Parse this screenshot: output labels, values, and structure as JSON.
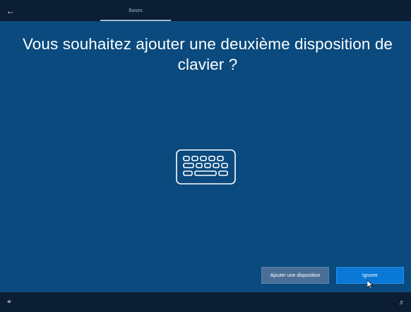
{
  "topbar": {
    "back_icon": "back-arrow-icon",
    "step_label": "Bases"
  },
  "main": {
    "title": "Vous souhaitez ajouter une deuxième disposition de clavier ?",
    "illustration_icon": "keyboard-icon"
  },
  "actions": {
    "add_layout_label": "Ajouter une disposition",
    "skip_label": "Ignorer"
  },
  "bottombar": {
    "left_icon": "ease-of-access-icon",
    "right_icon": "volume-icon"
  },
  "colors": {
    "background": "#0a4a7e",
    "bar": "#0c1e33",
    "primary_button": "#0a78d7",
    "secondary_button": "#4a6f96"
  }
}
